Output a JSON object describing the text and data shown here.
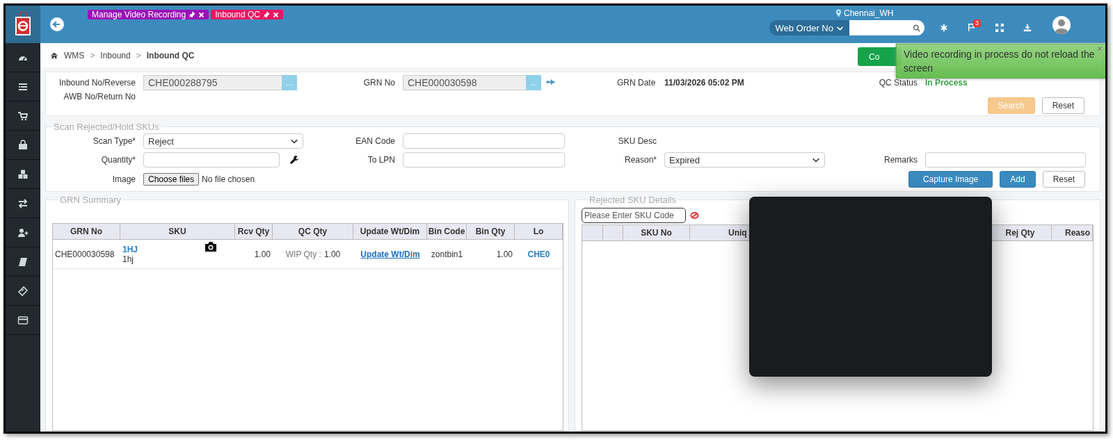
{
  "header": {
    "tabs": [
      {
        "label": "Manage Video Recording",
        "color": "#9b12b8"
      },
      {
        "label": "Inbound QC",
        "color": "#e91662"
      }
    ],
    "location": "Chennai_WH",
    "search_type": "Web Order No",
    "notification_count": "3"
  },
  "breadcrumb": [
    {
      "label": "WMS"
    },
    {
      "separator": ">",
      "label": "Inbound"
    },
    {
      "separator": ">",
      "label": "Inbound QC"
    }
  ],
  "action_button": {
    "label": "Co",
    "kind": "success"
  },
  "top_form": {
    "inbound_label": "Inbound No/Reverse",
    "inbound_value": "CHE000288795",
    "lookup": "...",
    "grn_label": "GRN No",
    "grn_value": "CHE000030598",
    "grn_date_label": "GRN Date",
    "grn_date": "11/03/2026 05:02 PM",
    "qc_status_label": "QC Status",
    "qc_status": "In Process",
    "awb_label": "AWB No/Return No",
    "buttons": [
      {
        "label": "Search",
        "kind": "warning"
      },
      {
        "label": "Reset",
        "kind": "default"
      }
    ]
  },
  "scan": {
    "legend": "Scan Rejected/Hold SKUs",
    "rows": [
      [
        {
          "kind": "select",
          "label": "Scan Type*",
          "value": "Reject"
        },
        {
          "kind": "input",
          "label": "EAN Code"
        },
        {
          "kind": "text",
          "label": "SKU Desc"
        }
      ],
      [
        {
          "kind": "input",
          "label": "Quantity*",
          "tool_icon": true
        },
        {
          "kind": "input",
          "label": "To LPN"
        },
        {
          "kind": "select",
          "label": "Reason*",
          "value": "Expired"
        },
        {
          "kind": "input",
          "label": "Remarks"
        }
      ],
      [
        {
          "kind": "file",
          "label": "Image",
          "button": "Choose files",
          "value": "No file chosen"
        }
      ]
    ],
    "buttons": [
      {
        "label": "Capture Image",
        "kind": "primary"
      },
      {
        "label": "Add",
        "kind": "primary"
      },
      {
        "label": "Reset",
        "kind": "default"
      }
    ]
  },
  "grn_summary": {
    "legend": "GRN Summary",
    "columns": [
      "GRN No",
      "SKU",
      "Rcv Qty",
      "QC Qty",
      "Update Wt/Dim",
      "Bin Code",
      "Bin Qty",
      "Lo"
    ],
    "rows": [
      {
        "grn_no": "CHE000030598",
        "sku_code": "1HJ",
        "sku_desc": "1hj",
        "rcv_qty": "1.00",
        "qc_label": "WIP Qty :",
        "qc_qty": "1.00",
        "update_link": "Update Wt/Dim",
        "bin_code": "zontbin1",
        "bin_qty": "1.00",
        "column_8": "CHE0"
      }
    ]
  },
  "rejected": {
    "legend": "Rejected SKU Details",
    "search_placeholder": "Please Enter SKU Code",
    "columns": [
      "SKU No",
      "Uniq",
      "Rej Qty",
      "Reaso"
    ]
  },
  "toast": {
    "message": "Video recording in process do not reload the screen",
    "close": "×"
  }
}
